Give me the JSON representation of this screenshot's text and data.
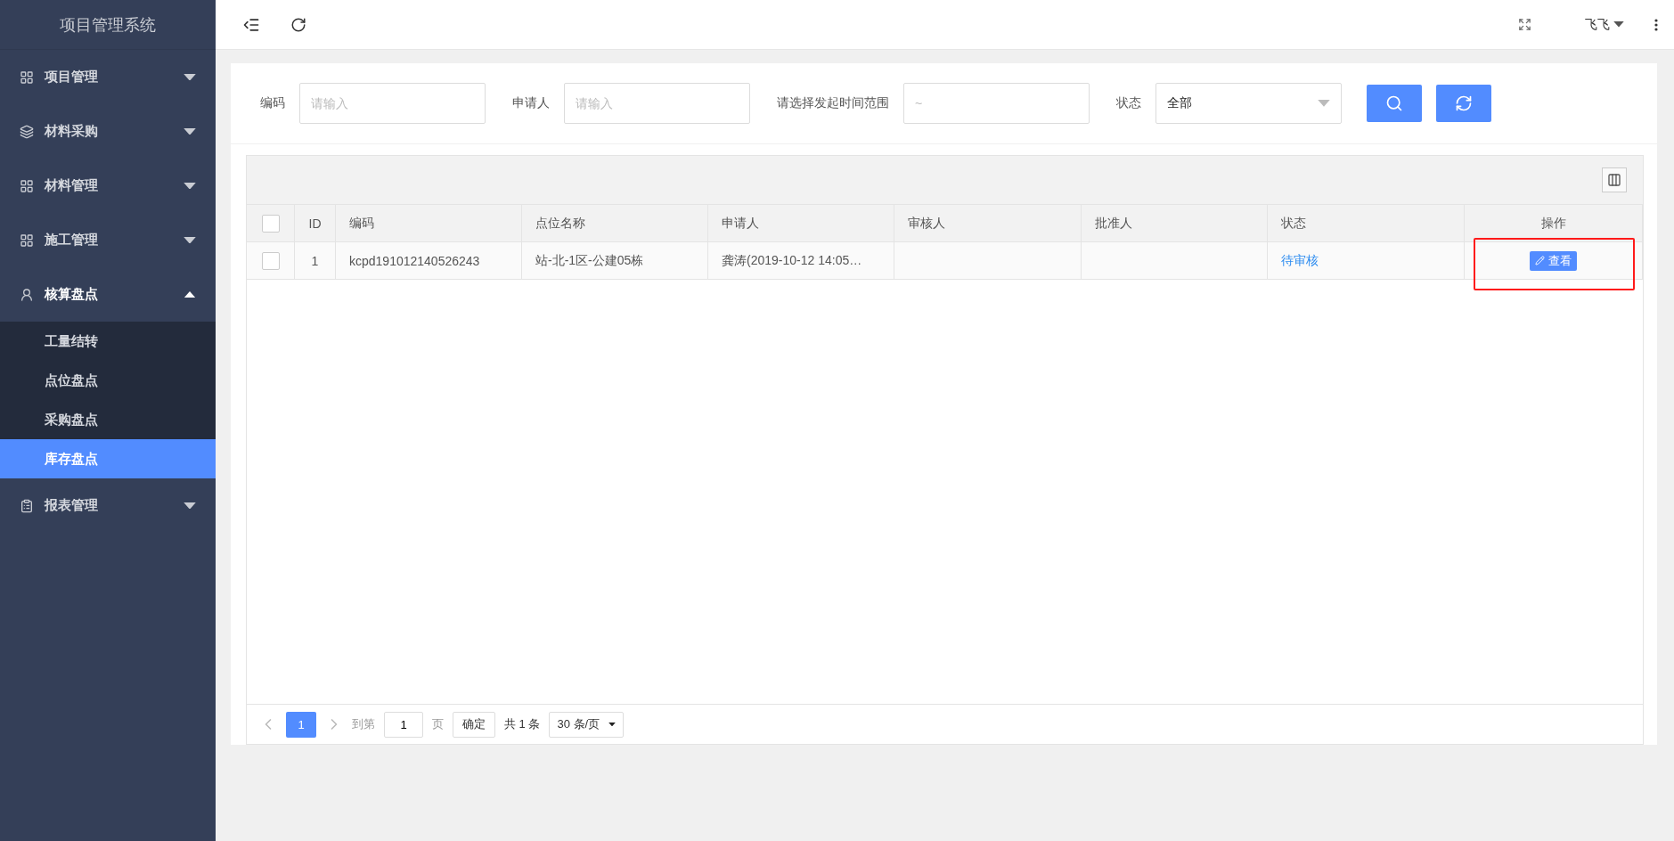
{
  "sidebar": {
    "title": "项目管理系统",
    "items": [
      {
        "label": "项目管理",
        "expanded": false
      },
      {
        "label": "材料采购",
        "expanded": false
      },
      {
        "label": "材料管理",
        "expanded": false
      },
      {
        "label": "施工管理",
        "expanded": false
      },
      {
        "label": "核算盘点",
        "expanded": true,
        "children": [
          {
            "label": "工量结转",
            "selected": false
          },
          {
            "label": "点位盘点",
            "selected": false
          },
          {
            "label": "采购盘点",
            "selected": false
          },
          {
            "label": "库存盘点",
            "selected": true
          }
        ]
      },
      {
        "label": "报表管理",
        "expanded": false
      }
    ]
  },
  "topbar": {
    "user": "飞飞"
  },
  "filters": [
    {
      "kind": "input",
      "label": "编码",
      "placeholder": "请输入"
    },
    {
      "kind": "input",
      "label": "申请人",
      "placeholder": "请输入"
    },
    {
      "kind": "input",
      "label": "请选择发起时间范围",
      "placeholder": "~"
    },
    {
      "kind": "select",
      "label": "状态",
      "value": "全部"
    }
  ],
  "table": {
    "header_checked": false,
    "columns": [
      "ID",
      "编码",
      "点位名称",
      "申请人",
      "审核人",
      "批准人",
      "状态",
      "操作"
    ],
    "rows": [
      {
        "checked": false,
        "id": "1",
        "code": "kcpd191012140526243",
        "site": "站-北-1区-公建05栋",
        "applicant": "龚涛(2019-10-12 14:05…",
        "reviewer": "",
        "approver": "",
        "status": "待审核",
        "action": "查看"
      }
    ]
  },
  "pagination": {
    "pages": [
      {
        "label": "1",
        "selected": true
      }
    ],
    "goto_label": "到第",
    "goto_value": "1",
    "page_unit": "页",
    "confirm": "确定",
    "total": "共 1 条",
    "page_size": "30 条/页"
  }
}
